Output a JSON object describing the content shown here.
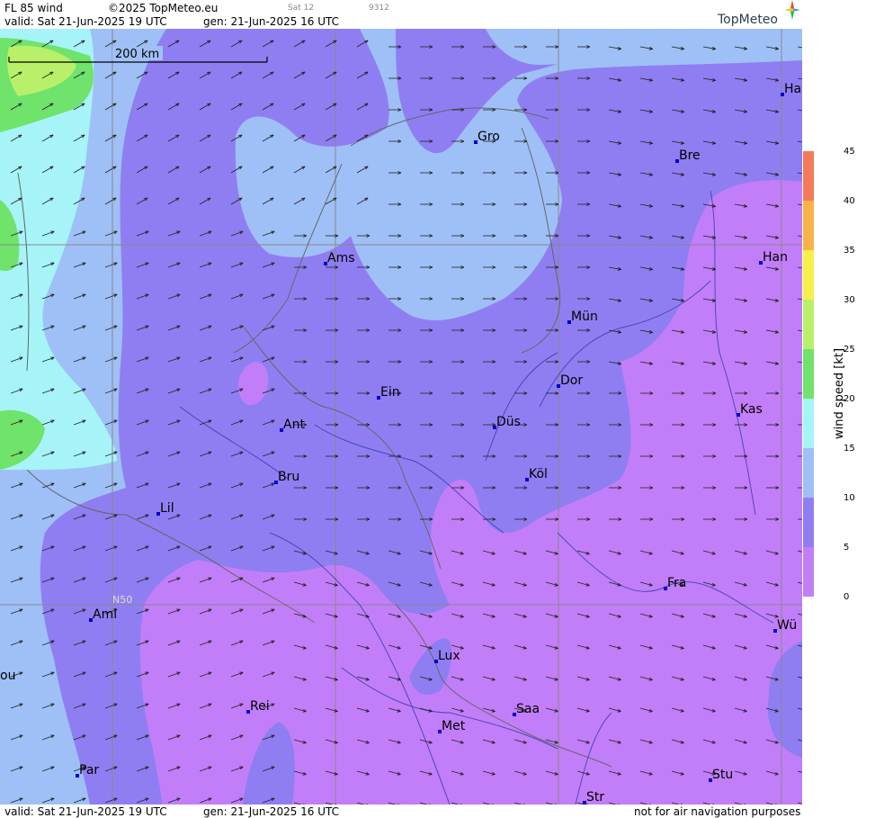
{
  "header": {
    "product": "FL 85 wind",
    "copyright": "©2025 TopMeteo.eu",
    "sat": "Sat 12",
    "code": "9312",
    "valid": "valid:  Sat  21-Jun-2025  19 UTC",
    "gen": "gen: 21-Jun-2025 16 UTC",
    "brand": "TopMeteo"
  },
  "footer": {
    "valid": "valid:  Sat  21-Jun-2025  19 UTC",
    "gen": "gen: 21-Jun-2025 16 UTC",
    "notice": "not for air navigation purposes"
  },
  "scale_bar": {
    "label": "200 km"
  },
  "grid_label": "N50",
  "legend": {
    "title": "wind speed [kt]",
    "ticks": [
      "45",
      "40",
      "35",
      "30",
      "25",
      "20",
      "15",
      "10",
      "5",
      "0"
    ],
    "colors": {
      "0-5": "#c27ef8",
      "5-10": "#8f7ef2",
      "10-15": "#9fc0f6",
      "15-20": "#a6f4f8",
      "20-25": "#6fe36b",
      "25-30": "#b9f06a",
      "30-35": "#f7f04a",
      "35-40": "#f8b24a",
      "40-45": "#f47a5a"
    }
  },
  "cities": [
    {
      "name": "Ha"
    },
    {
      "name": "Gro"
    },
    {
      "name": "Bre"
    },
    {
      "name": "Ams"
    },
    {
      "name": "Han"
    },
    {
      "name": "Mün"
    },
    {
      "name": "Ein"
    },
    {
      "name": "Dor"
    },
    {
      "name": "Ant"
    },
    {
      "name": "Düs"
    },
    {
      "name": "Kas"
    },
    {
      "name": "Bru"
    },
    {
      "name": "Köl"
    },
    {
      "name": "Lil"
    },
    {
      "name": "Fra"
    },
    {
      "name": "Ami"
    },
    {
      "name": "Wü"
    },
    {
      "name": "Lux"
    },
    {
      "name": "ou"
    },
    {
      "name": "Rei"
    },
    {
      "name": "Saa"
    },
    {
      "name": "Met"
    },
    {
      "name": "Par"
    },
    {
      "name": "Stu"
    },
    {
      "name": "Str"
    }
  ]
}
